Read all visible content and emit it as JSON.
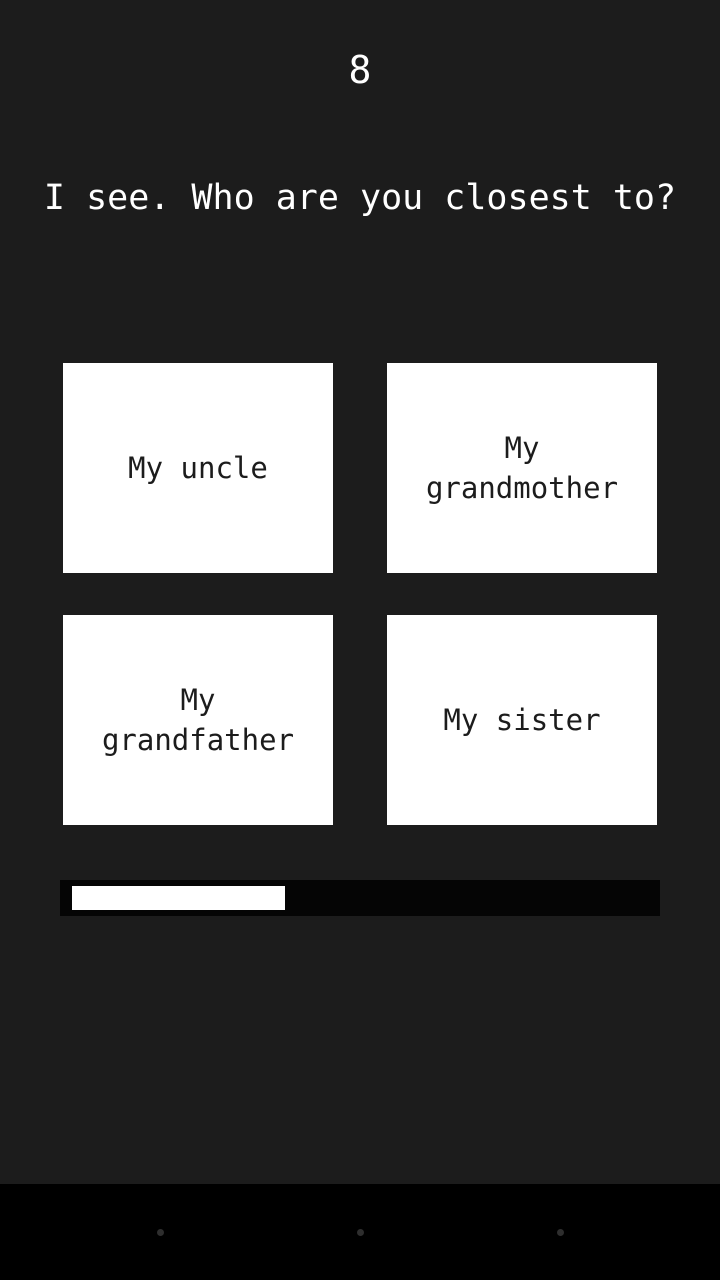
{
  "counter": "8",
  "question": "I see. Who are you closest to?",
  "choices": [
    {
      "label": "My uncle"
    },
    {
      "label": "My grandmother"
    },
    {
      "label": "My grandfather"
    },
    {
      "label": "My sister"
    }
  ],
  "progress": {
    "fraction": 0.37
  },
  "navbar": {
    "back_icon": "nav-back-dot",
    "home_icon": "nav-home-dot",
    "recent_icon": "nav-recent-dot"
  },
  "colors": {
    "background": "#1c1c1c",
    "card": "#ffffff",
    "progress_track": "#050505",
    "progress_fill": "#ffffff",
    "navbar": "#000000"
  }
}
